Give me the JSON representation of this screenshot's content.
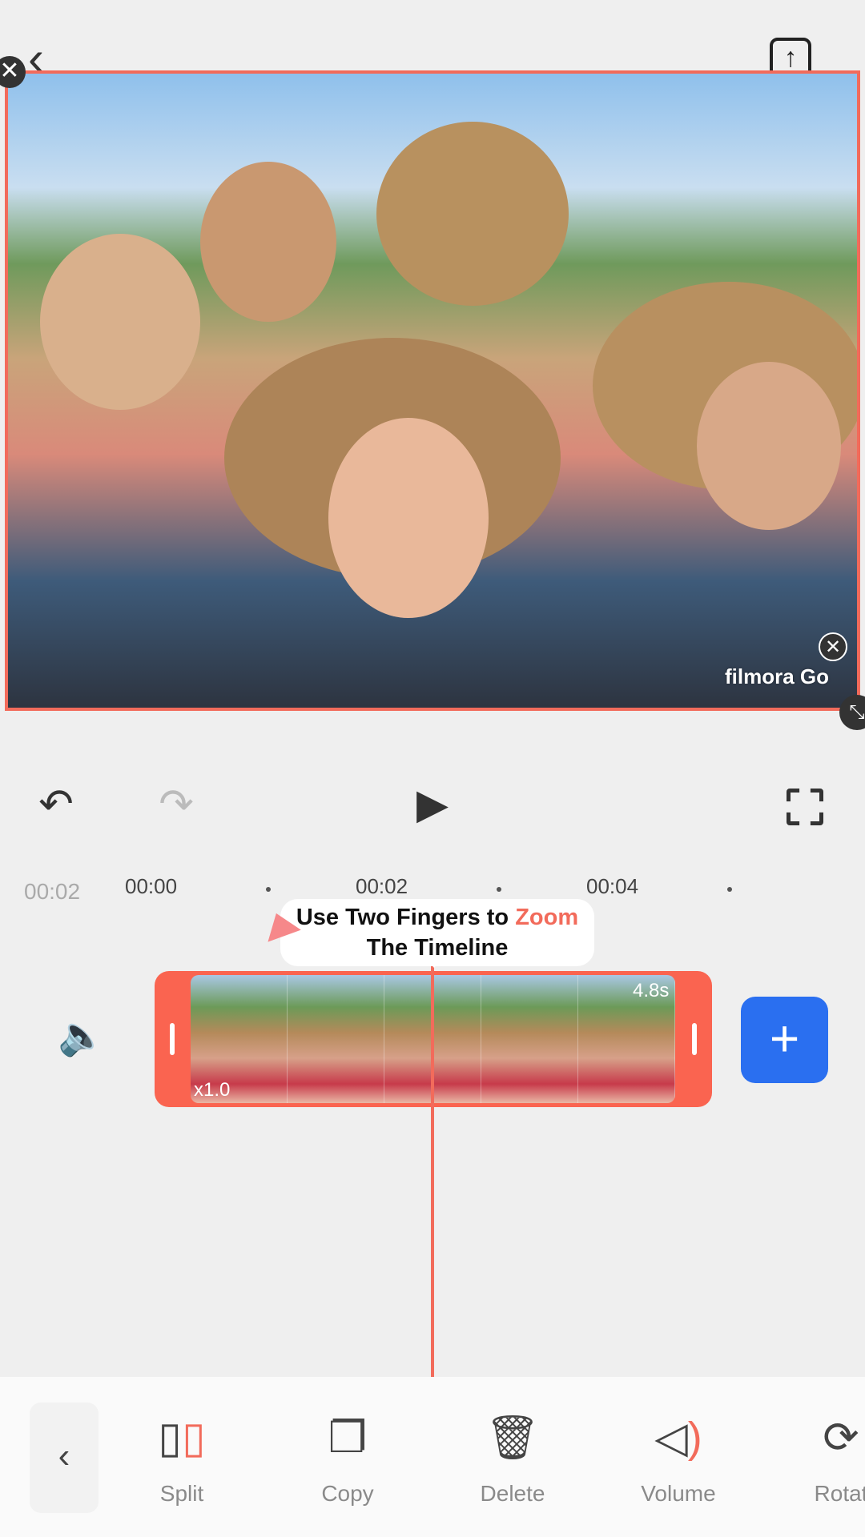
{
  "header": {
    "back_icon": "chevron-left-icon",
    "export_icon": "export-upload-icon"
  },
  "preview": {
    "watermark": "filmora Go",
    "accent": "#f26b5b"
  },
  "controls": {
    "undo_icon": "undo-icon",
    "redo_icon": "redo-icon",
    "play_icon": "play-icon",
    "fullscreen_icon": "fullscreen-icon"
  },
  "ruler": {
    "current": "00:02",
    "ticks": [
      "00:00",
      "00:02",
      "00:04"
    ]
  },
  "tooltip": {
    "line1_prefix": "Use Two Fingers to ",
    "line1_highlight": "Zoom",
    "line2": "The Timeline"
  },
  "clip": {
    "speed": "x1.0",
    "duration": "4.8s",
    "color": "#fa6450"
  },
  "add_button": {
    "label": "+",
    "color": "#2a6ff0"
  },
  "toolbar": {
    "items": [
      {
        "label": "Split",
        "icon": "split-icon"
      },
      {
        "label": "Copy",
        "icon": "copy-icon"
      },
      {
        "label": "Delete",
        "icon": "delete-icon"
      },
      {
        "label": "Volume",
        "icon": "volume-icon"
      },
      {
        "label": "Rotat",
        "icon": "rotate-icon"
      }
    ]
  }
}
